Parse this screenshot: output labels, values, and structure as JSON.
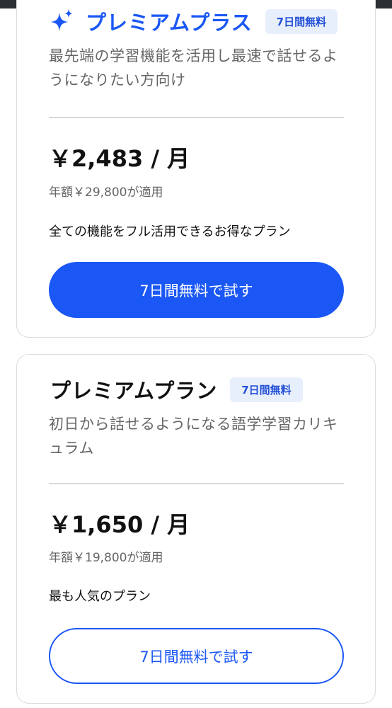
{
  "plans": [
    {
      "title": "プレミアムプラス",
      "badge": "7日間無料",
      "description": "最先端の学習機能を活用し最速で話せるようになりたい方向け",
      "price": "￥2,483 / 月",
      "annual": "年額￥29,800が適用",
      "note": "全ての機能をフル活用できるお得なプラン",
      "cta_label": "7日間無料で試す",
      "icon": "sparkle-icon"
    },
    {
      "title": "プレミアムプラン",
      "badge": "7日間無料",
      "description": "初日から話せるようになる語学学習カリキュラム",
      "price": "￥1,650 / 月",
      "annual": "年額￥19,800が適用",
      "note": "最も人気のプラン",
      "cta_label": "7日間無料で試す"
    }
  ],
  "colors": {
    "accent": "#1a57f5",
    "badge_bg": "#e8effc",
    "badge_text": "#2351d6"
  }
}
